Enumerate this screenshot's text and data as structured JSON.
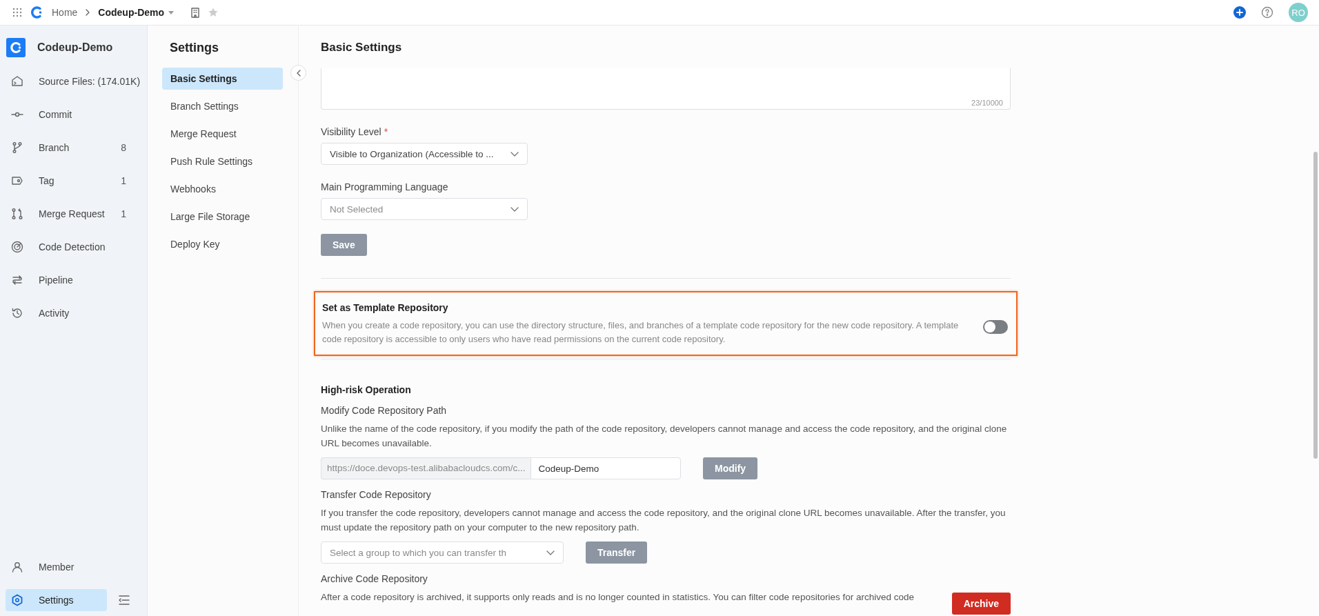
{
  "topbar": {
    "home": "Home",
    "project": "Codeup-Demo",
    "avatar": "RO"
  },
  "sidebar": {
    "project": "Codeup-Demo",
    "items": [
      {
        "label": "Source Files: (174.01K)",
        "selected": false
      },
      {
        "label": "Commit",
        "selected": false
      },
      {
        "label": "Branch",
        "count": "8",
        "selected": false
      },
      {
        "label": "Tag",
        "count": "1",
        "selected": false
      },
      {
        "label": "Merge Request",
        "count": "1",
        "selected": false
      },
      {
        "label": "Code Detection",
        "selected": false
      },
      {
        "label": "Pipeline",
        "selected": false
      },
      {
        "label": "Activity",
        "selected": false
      }
    ],
    "bottom_items": [
      {
        "label": "Member",
        "selected": false
      },
      {
        "label": "Settings",
        "selected": true
      }
    ]
  },
  "settings_nav": {
    "title": "Settings",
    "items": [
      {
        "label": "Basic Settings",
        "selected": true
      },
      {
        "label": "Branch Settings",
        "selected": false
      },
      {
        "label": "Merge Request",
        "selected": false
      },
      {
        "label": "Push Rule Settings",
        "selected": false
      },
      {
        "label": "Webhooks",
        "selected": false
      },
      {
        "label": "Large File Storage",
        "selected": false
      },
      {
        "label": "Deploy Key",
        "selected": false
      }
    ]
  },
  "main": {
    "title": "Basic Settings",
    "description_counter": "23/10000",
    "visibility": {
      "label": "Visibility Level",
      "required_mark": "*",
      "value": "Visible to Organization (Accessible to ..."
    },
    "language": {
      "label": "Main Programming Language",
      "placeholder": "Not Selected"
    },
    "save_button": {
      "label": "Save",
      "disabled": true
    },
    "template": {
      "highlighted": true,
      "title": "Set as Template Repository",
      "description": "When you create a code repository, you can use the directory structure, files, and branches of a template code repository for the new code repository. A template code repository is accessible to only users who have read permissions on the current code repository.",
      "toggle": {
        "on": false
      }
    },
    "high_risk": {
      "title": "High-risk Operation",
      "modify_path": {
        "label": "Modify Code Repository Path",
        "description": "Unlike the name of the code repository, if you modify the path of the code repository, developers cannot manage and access the code repository, and the original clone URL becomes unavailable.",
        "url_prefix": "https://doce.devops-test.alibabacloudcs.com/c...",
        "value": "Codeup-Demo",
        "button": {
          "label": "Modify",
          "disabled": true
        }
      },
      "transfer": {
        "label": "Transfer Code Repository",
        "description": "If you transfer the code repository, developers cannot manage and access the code repository, and the original clone URL becomes unavailable. After the transfer, you must update the repository path on your computer to the new repository path.",
        "placeholder": "Select a group to which you can transfer th",
        "button": {
          "label": "Transfer",
          "disabled": true
        }
      },
      "archive": {
        "label": "Archive Code Repository",
        "description": "After a code repository is archived, it supports only reads and is no longer counted in statistics. You can filter code repositories for archived code",
        "button": {
          "label": "Archive",
          "disabled": false
        }
      }
    }
  }
}
